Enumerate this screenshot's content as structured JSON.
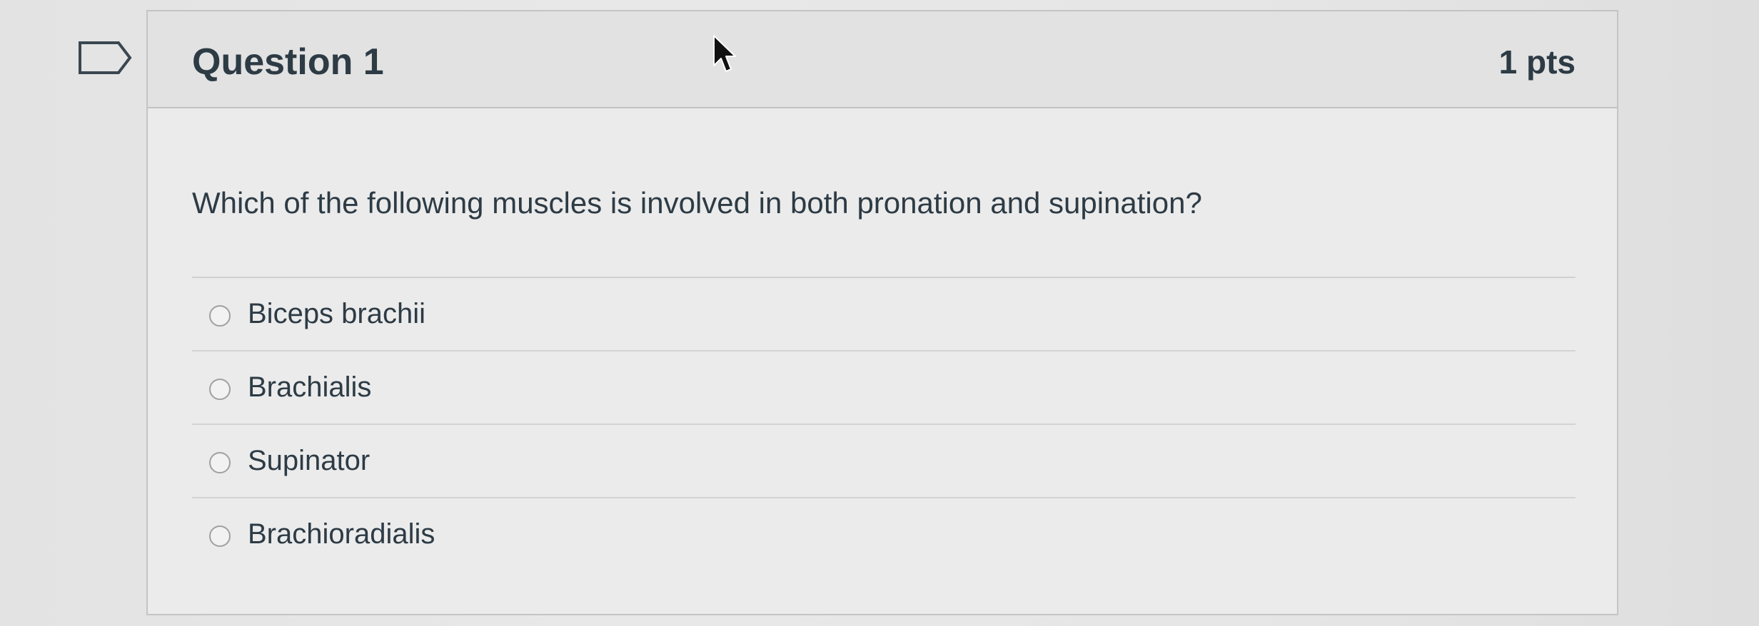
{
  "question": {
    "title": "Question 1",
    "points": "1 pts",
    "text": "Which of the following muscles is involved in both pronation and supination?",
    "answers": [
      {
        "label": "Biceps brachii",
        "selected": false
      },
      {
        "label": "Brachialis",
        "selected": false
      },
      {
        "label": "Supinator",
        "selected": false
      },
      {
        "label": "Brachioradialis",
        "selected": false
      }
    ]
  },
  "icons": {
    "flag": "flag-question-icon",
    "cursor": "mouse-pointer-icon"
  },
  "colors": {
    "text": "#2d3b45",
    "header_bg": "#e2e2e2",
    "border": "#c4c4c4"
  }
}
